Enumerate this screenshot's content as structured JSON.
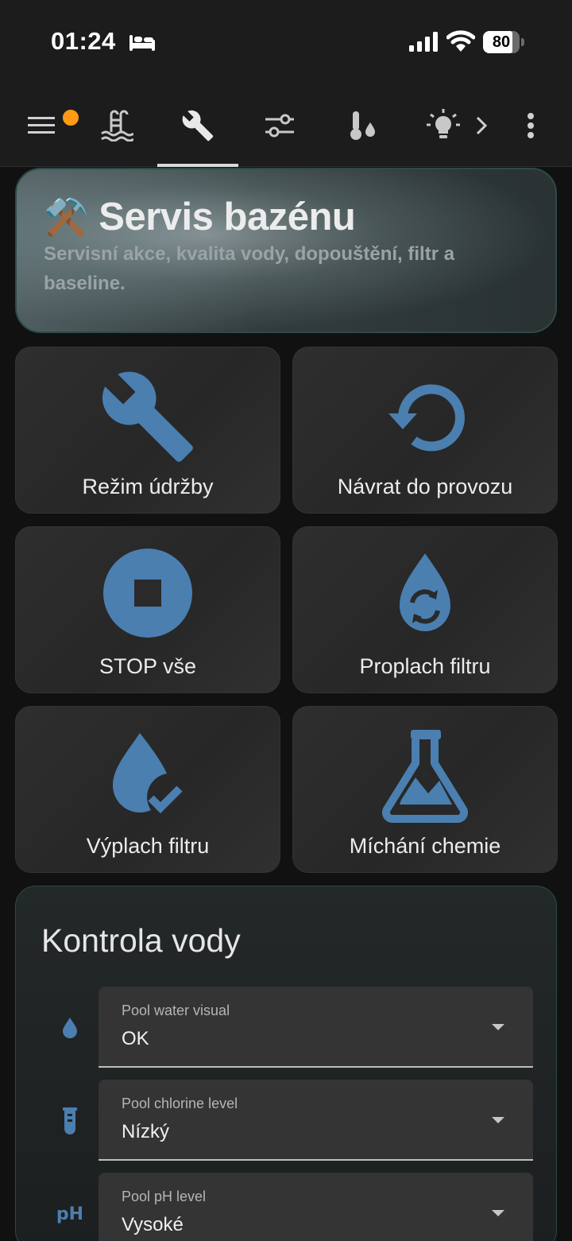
{
  "status_bar": {
    "time": "01:24",
    "battery": "80",
    "battery_level": 0.8,
    "icons": [
      "bed-icon",
      "signal-icon",
      "wifi-icon",
      "battery-icon"
    ]
  },
  "toolbar": {
    "tabs": [
      {
        "name": "menu-icon",
        "has_badge": true
      },
      {
        "name": "pool-icon"
      },
      {
        "name": "wrench-icon",
        "active": true
      },
      {
        "name": "tune-icon"
      },
      {
        "name": "thermometer-water-icon"
      },
      {
        "name": "lightbulb-icon"
      },
      {
        "name": "chevron-right-icon"
      },
      {
        "name": "more-vert-icon"
      }
    ]
  },
  "header": {
    "emoji": "⚒️",
    "title": "Servis bazénu",
    "subtitle": "Servisní akce, kvalita vody, dopouštění, filtr a baseline."
  },
  "actions": [
    {
      "label": "Režim údržby",
      "icon": "wrench-icon"
    },
    {
      "label": "Návrat do provozu",
      "icon": "restore-icon"
    },
    {
      "label": "STOP vše",
      "icon": "stop-circle-icon"
    },
    {
      "label": "Proplach filtru",
      "icon": "water-sync-icon"
    },
    {
      "label": "Výplach filtru",
      "icon": "water-check-icon"
    },
    {
      "label": "Míchání chemie",
      "icon": "flask-icon"
    }
  ],
  "water_check": {
    "title": "Kontrola vody",
    "selects": [
      {
        "label": "Pool water visual",
        "value": "OK",
        "icon": "water-drop-icon"
      },
      {
        "label": "Pool chlorine level",
        "value": "Nízký",
        "icon": "test-tube-icon"
      },
      {
        "label": "Pool pH level",
        "value": "Vysoké",
        "icon": "ph-icon",
        "icon_text": "pH"
      }
    ]
  },
  "colors": {
    "accent": "#4a7fb0",
    "badge": "#ff9a14",
    "background": "#111111",
    "tile": "#2b2b2b"
  }
}
